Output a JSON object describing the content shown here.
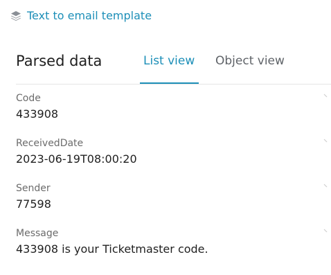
{
  "header_link": {
    "label": "Text to email template",
    "icon": "layers-icon",
    "color": "#1d8fb8"
  },
  "panel": {
    "title": "Parsed data",
    "tabs": [
      {
        "label": "List view",
        "active": true
      },
      {
        "label": "Object view",
        "active": false
      }
    ]
  },
  "fields": [
    {
      "label": "Code",
      "value": "433908"
    },
    {
      "label": "ReceivedDate",
      "value": "2023-06-19T08:00:20"
    },
    {
      "label": "Sender",
      "value": "77598"
    },
    {
      "label": "Message",
      "value": "433908 is your Ticketmaster code."
    }
  ]
}
